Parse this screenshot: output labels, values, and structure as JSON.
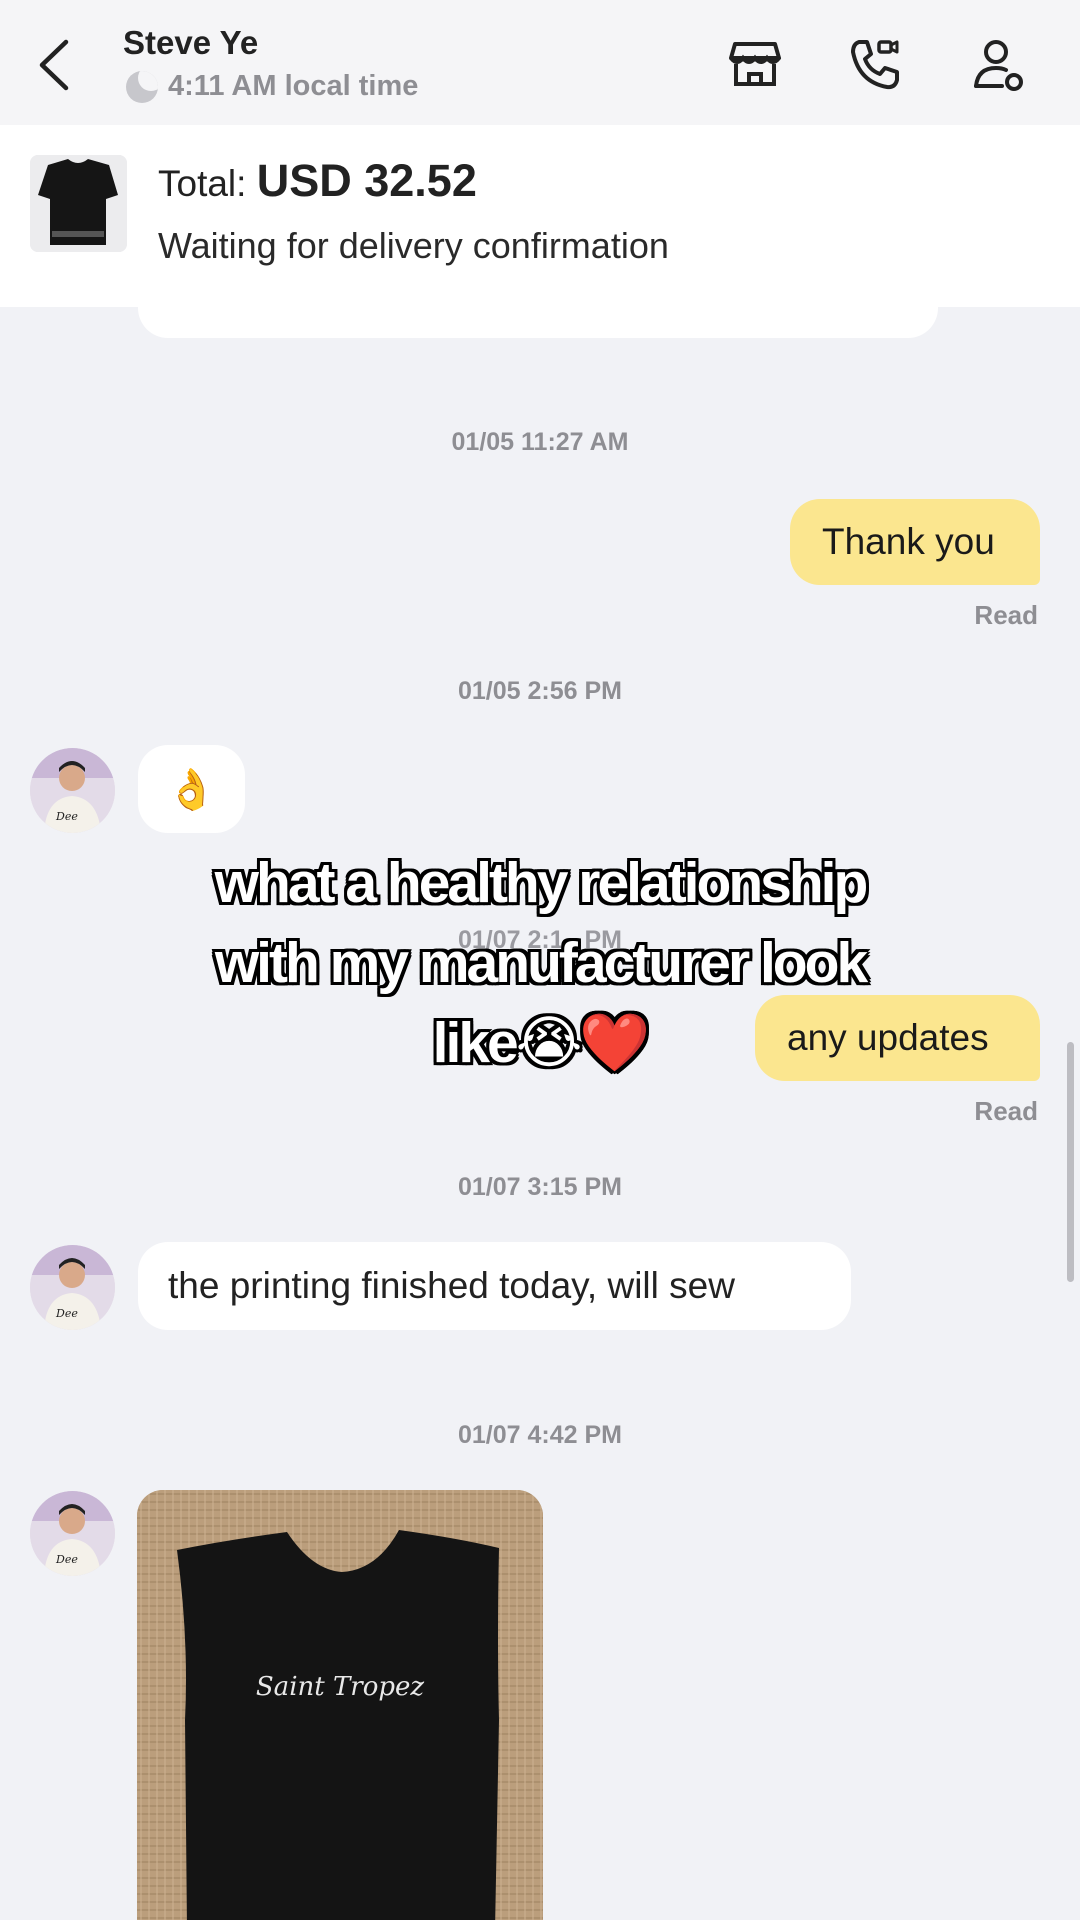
{
  "header": {
    "contact_name": "Steve Ye",
    "local_time": "4:11 AM local time",
    "icons": [
      "back-icon",
      "store-icon",
      "video-call-icon",
      "user-settings-icon"
    ]
  },
  "order": {
    "total_label": "Total:",
    "total_value": "USD 32.52",
    "status": "Waiting for delivery confirmation"
  },
  "messages": {
    "ts1": "01/05 11:27 AM",
    "thank_you": "Thank you",
    "read1": "Read",
    "ts2": "01/05 2:56 PM",
    "ok_emoji": "👌",
    "ts3": "01/07 2:1_ PM",
    "any_updates": "any updates",
    "read2": "Read",
    "ts4": "01/07 3:15 PM",
    "printing": "the printing finished today, will sew",
    "ts5": "01/07 4:42 PM"
  },
  "overlay": {
    "line1": "what a healthy relationship",
    "line2": "with my manufacturer look",
    "line3": "like😭❤️"
  },
  "photo": {
    "print_text": "Saint Tropez"
  },
  "colors": {
    "outgoing_bubble": "#fbe68f",
    "background": "#f1f2f6",
    "meta_text": "#8e8e93"
  }
}
